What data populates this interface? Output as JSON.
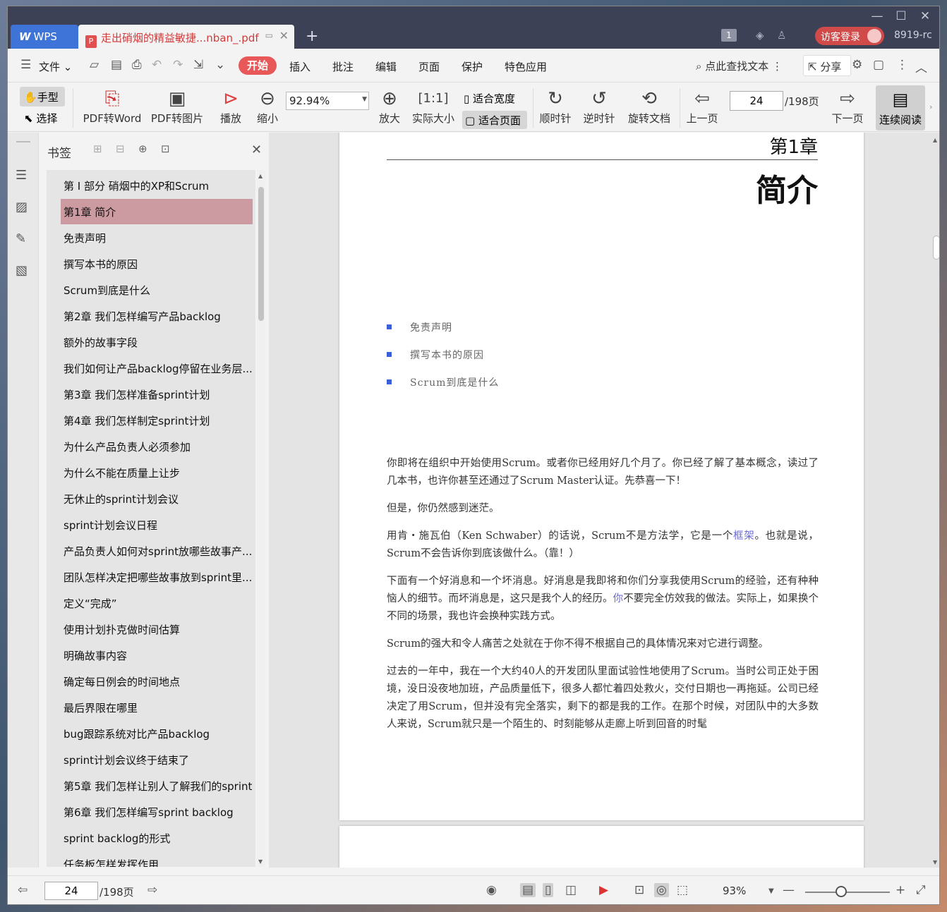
{
  "titlebar": {
    "app_tab": "WPS",
    "doc_tab": "走出硝烟的精益敏捷...nban_.pdf",
    "badge": "1",
    "login": "访客登录",
    "user_id": "8919-rc"
  },
  "menu": {
    "file": "文件",
    "active": "开始",
    "items": [
      "插入",
      "批注",
      "编辑",
      "页面",
      "保护",
      "特色应用"
    ],
    "search": "点此查找文本",
    "share": "分享"
  },
  "ribbon": {
    "hand": "手型",
    "select": "选择",
    "pdf_word": "PDF转Word",
    "pdf_img": "PDF转图片",
    "play": "播放",
    "zoom_out": "缩小",
    "zoom_value": "92.94%",
    "zoom_in": "放大",
    "actual_size": "实际大小",
    "fit_width": "适合宽度",
    "fit_page": "适合页面",
    "clockwise": "顺时针",
    "counterclockwise": "逆时针",
    "rotate_doc": "旋转文档",
    "prev_page": "上一页",
    "page": "24",
    "total": "/198页",
    "next_page": "下一页",
    "continuous": "连续阅读"
  },
  "bookmarks": {
    "title": "书签",
    "items": [
      "第 I 部分 硝烟中的XP和Scrum",
      "第1章 简介",
      "免责声明",
      "撰写本书的原因",
      "Scrum到底是什么",
      "第2章 我们怎样编写产品backlog",
      "额外的故事字段",
      "我们如何让产品backlog停留在业务层...",
      "第3章 我们怎样准备sprint计划",
      "第4章 我们怎样制定sprint计划",
      "为什么产品负责人必须参加",
      "为什么不能在质量上让步",
      "无休止的sprint计划会议",
      "sprint计划会议日程",
      "产品负责人如何对sprint放哪些故事产...",
      "团队怎样决定把哪些故事放到sprint里...",
      "定义“完成”",
      "使用计划扑克做时间估算",
      "明确故事内容",
      "确定每日例会的时间地点",
      "最后界限在哪里",
      "bug跟踪系统对比产品backlog",
      "sprint计划会议终于结束了",
      "第5章 我们怎样让别人了解我们的sprint",
      "第6章 我们怎样编写sprint backlog",
      "sprint backlog的形式",
      "任务板怎样发挥作用"
    ]
  },
  "document": {
    "chapter_no": "第1章",
    "chapter_title": "简介",
    "toc": [
      "免责声明",
      "撰写本书的原因",
      "Scrum到底是什么"
    ],
    "p1": "你即将在组织中开始使用Scrum。或者你已经用好几个月了。你已经了解了基本概念，读过了几本书，也许你甚至还通过了Scrum Master认证。先恭喜一下！",
    "p2": "但是，你仍然感到迷茫。",
    "p3a": "用肯・施瓦伯（Ken Schwaber）的话说，Scrum不是方法学，它是一个",
    "p3_link": "框架",
    "p3b": "。也就是说，Scrum不会告诉你到底该做什么。（靠！）",
    "p4a": "下面有一个好消息和一个坏消息。好消息是我即将和你们分享我使用Scrum的经验，还有种种恼人的细节。而坏消息是，这只是我个人的经历。",
    "p4_link": "你",
    "p4b": "不要完全仿效我的做法。实际上，如果换个不同的场景，我也许会换种实践方式。",
    "p5": "Scrum的强大和令人痛苦之处就在于你不得不根据自己的具体情况来对它进行调整。",
    "p6": "过去的一年中，我在一个大约40人的开发团队里面试验性地使用了Scrum。当时公司正处于困境，没日没夜地加班，产品质量低下，很多人都忙着四处救火，交付日期也一再拖延。公司已经决定了用Scrum，但并没有完全落实，剩下的都是我的工作。在那个时候，对团队中的大多数人来说，Scrum就只是一个陌生的、时刻能够从走廊上听到回音的时髦"
  },
  "status": {
    "page": "24",
    "total": "/198页",
    "zoom": "93%"
  },
  "colors": {
    "titlebar": "#3c4156",
    "accent": "#e85858",
    "bookmark_active": "#cc9aa1",
    "toc_bullet": "#3a5fd9"
  }
}
